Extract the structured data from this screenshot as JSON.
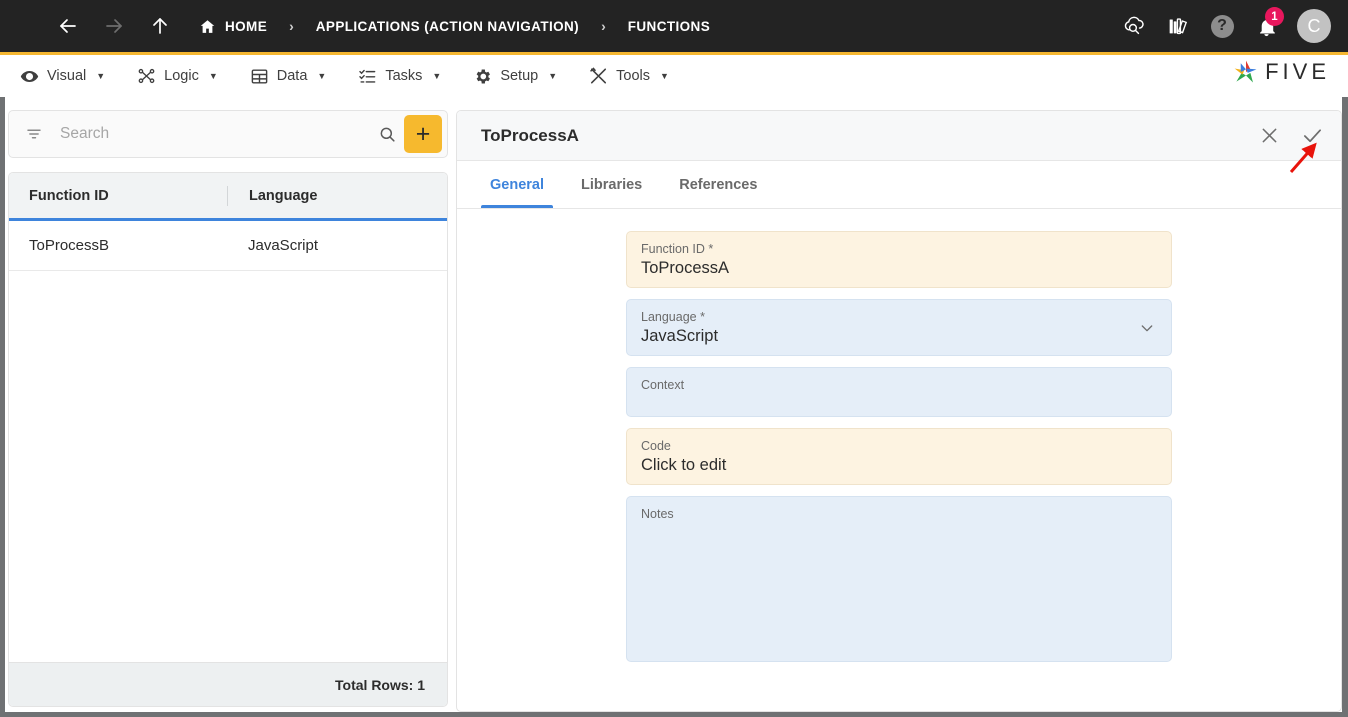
{
  "topbar": {
    "menu_icon": "hamburger-icon",
    "back_icon": "arrow-left-icon",
    "forward_icon": "arrow-right-icon",
    "up_icon": "arrow-up-icon",
    "breadcrumbs": [
      {
        "label": "HOME",
        "icon": "home-icon"
      },
      {
        "label": "APPLICATIONS (ACTION NAVIGATION)",
        "icon": ""
      },
      {
        "label": "FUNCTIONS",
        "icon": ""
      }
    ],
    "separator": "›",
    "actions": [
      {
        "name": "cloud-search-icon"
      },
      {
        "name": "books-library-icon"
      },
      {
        "name": "help-icon",
        "label": "?"
      },
      {
        "name": "notifications-bell-icon",
        "badge": "1"
      }
    ],
    "avatar_initial": "C",
    "badge_color": "#e8175d",
    "accent_color": "#f5b731",
    "background_color": "#232323"
  },
  "menubar": {
    "items": [
      {
        "label": "Visual",
        "icon": "eye-icon"
      },
      {
        "label": "Logic",
        "icon": "logic-nodes-icon"
      },
      {
        "label": "Data",
        "icon": "table-grid-icon"
      },
      {
        "label": "Tasks",
        "icon": "task-list-icon"
      },
      {
        "label": "Setup",
        "icon": "gear-icon"
      },
      {
        "label": "Tools",
        "icon": "tools-icon"
      }
    ],
    "caret": "▼",
    "brand": "FIVE"
  },
  "sidebar": {
    "search": {
      "placeholder": "Search",
      "value": "",
      "filter_icon": "filter-icon",
      "search_icon": "search-icon"
    },
    "add_button_label": "+",
    "add_button_color": "#f6b92e",
    "grid": {
      "columns": [
        "Function ID",
        "Language"
      ],
      "header_underline_color": "#3e84dc",
      "rows": [
        {
          "function_id": "ToProcessB",
          "language": "JavaScript"
        }
      ]
    },
    "footer_label": "Total Rows: 1"
  },
  "panel": {
    "title": "ToProcessA",
    "close_icon": "close-icon",
    "save_icon": "check-icon",
    "tabs": [
      {
        "label": "General",
        "active": true
      },
      {
        "label": "Libraries",
        "active": false
      },
      {
        "label": "References",
        "active": false
      }
    ],
    "active_tab_color": "#3e84dc",
    "fields": [
      {
        "label": "Function ID *",
        "value": "ToProcessA",
        "style": "cream",
        "control": "text"
      },
      {
        "label": "Language *",
        "value": "JavaScript",
        "style": "blue",
        "control": "select",
        "chevron_icon": "chevron-down-icon"
      },
      {
        "label": "Context",
        "value": "",
        "style": "blue",
        "control": "text"
      },
      {
        "label": "Code",
        "value": "Click to edit",
        "style": "cream",
        "control": "text"
      },
      {
        "label": "Notes",
        "value": "",
        "style": "blue",
        "control": "textarea"
      }
    ]
  },
  "annotation": {
    "arrow_color": "#e8130b",
    "points_at": "check-icon"
  }
}
